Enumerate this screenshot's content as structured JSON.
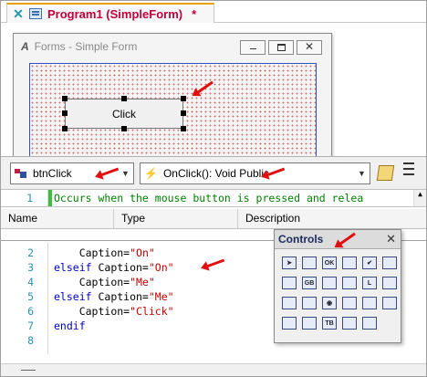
{
  "tab": {
    "title": "Program1 (SimpleForm)",
    "modified": "*"
  },
  "form": {
    "title": "Forms - Simple Form",
    "app_icon_text": "A",
    "button_caption": "Click",
    "window_buttons": {
      "close": "✕"
    }
  },
  "combos": {
    "object": "btnClick",
    "event": "OnClick(): Void Public",
    "dropdown_glyph": "▼"
  },
  "description_line": {
    "line_number": "1",
    "text": "Occurs when the mouse button is pressed and relea"
  },
  "columns": [
    "Name",
    "Type",
    "Description"
  ],
  "code_lines": [
    {
      "num": "2",
      "indent": "    ",
      "parts": [
        {
          "t": "Caption=",
          "c": "plain"
        },
        {
          "t": "\"On\"",
          "c": "str"
        }
      ]
    },
    {
      "num": "3",
      "indent": "",
      "parts": [
        {
          "t": "elseif ",
          "c": "kw"
        },
        {
          "t": "Caption=",
          "c": "plain"
        },
        {
          "t": "\"On\"",
          "c": "str"
        }
      ]
    },
    {
      "num": "4",
      "indent": "    ",
      "parts": [
        {
          "t": "Caption=",
          "c": "plain"
        },
        {
          "t": "\"Me\"",
          "c": "str"
        }
      ]
    },
    {
      "num": "5",
      "indent": "",
      "parts": [
        {
          "t": "elseif ",
          "c": "kw"
        },
        {
          "t": "Caption=",
          "c": "plain"
        },
        {
          "t": "\"Me\"",
          "c": "str"
        }
      ]
    },
    {
      "num": "6",
      "indent": "    ",
      "parts": [
        {
          "t": "Caption=",
          "c": "plain"
        },
        {
          "t": "\"Click\"",
          "c": "str"
        }
      ]
    },
    {
      "num": "7",
      "indent": "",
      "parts": [
        {
          "t": "endif",
          "c": "kw"
        }
      ]
    },
    {
      "num": "8",
      "indent": "",
      "parts": []
    }
  ],
  "palette": {
    "title": "Controls",
    "close": "✕",
    "items": [
      {
        "name": "pointer-tool-icon",
        "glyph": "➤"
      },
      {
        "name": "form-tool-icon",
        "glyph": ""
      },
      {
        "name": "command-button-tool-icon",
        "glyph": "OK"
      },
      {
        "name": "image-tool-icon",
        "glyph": ""
      },
      {
        "name": "checkbox-tool-icon",
        "glyph": "✔"
      },
      {
        "name": "listbox-tool-icon",
        "glyph": ""
      },
      {
        "name": "textbox-tool-icon",
        "glyph": ""
      },
      {
        "name": "grid-tool-icon",
        "glyph": "GB"
      },
      {
        "name": "picture-tool-icon",
        "glyph": ""
      },
      {
        "name": "pictures-tool-icon",
        "glyph": ""
      },
      {
        "name": "label-tool-icon",
        "glyph": "L"
      },
      {
        "name": "combo-tool-icon",
        "glyph": ""
      },
      {
        "name": "globe-tool-icon",
        "glyph": ""
      },
      {
        "name": "frame-tool-icon",
        "glyph": ""
      },
      {
        "name": "option-tool-icon",
        "glyph": "◉"
      },
      {
        "name": "scroll-tool-icon",
        "glyph": ""
      },
      {
        "name": "bars-tool-icon",
        "glyph": ""
      },
      {
        "name": "hscroll-tool-icon",
        "glyph": ""
      },
      {
        "name": "timer-tool-icon",
        "glyph": ""
      },
      {
        "name": "tabstrip-tool-icon",
        "glyph": ""
      },
      {
        "name": "tb-tool-icon",
        "glyph": "TB"
      },
      {
        "name": "circle-tool-icon",
        "glyph": ""
      },
      {
        "name": "data-tool-icon",
        "glyph": ""
      }
    ]
  },
  "colors": {
    "keyword": "#0000c0",
    "string": "#c00000",
    "comment": "#008000",
    "line_number": "#2b91af",
    "tab_title": "#c0003c",
    "annotation_arrow": "#e01010"
  }
}
